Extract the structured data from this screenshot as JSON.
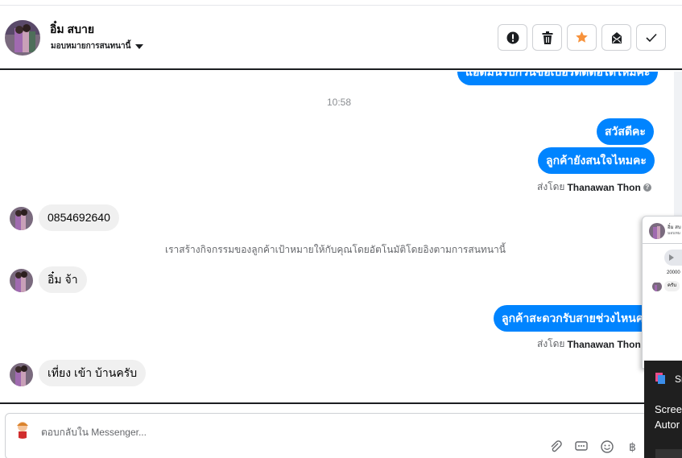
{
  "header": {
    "contact_name": "อิ๋ม สบาย",
    "assign_label": "มอบหมายการสนทนานี้",
    "actions": [
      {
        "name": "report",
        "icon": "exclamation-icon"
      },
      {
        "name": "delete",
        "icon": "trash-icon"
      },
      {
        "name": "star",
        "icon": "star-icon",
        "color": "#f7923b"
      },
      {
        "name": "move",
        "icon": "envelope-icon"
      },
      {
        "name": "done",
        "icon": "check-icon"
      }
    ]
  },
  "thread": {
    "cut_bubble": "แอดมินรบกวนขอเบอร์ติดต่อได้ไหมคะ",
    "time": "10:58",
    "out1": "สวัสดีคะ",
    "out2": "ลูกค้ายังสนใจไหมคะ",
    "sent_by_prefix": "ส่งโดย",
    "sent_by_name": "Thanawan Thon",
    "in1": "0854692640",
    "system_note": "เราสร้างกิจกรรมของลูกค้าเป้าหมายให้กับคุณโดยอัตโนมัติโดยอิงตามการสนทนานี้",
    "in2": "อิ๋ม จ้า",
    "out3": "ลูกค้าสะดวกรับสายช่วงไหนคะ",
    "sent_by_prefix2": "ส่งโดย",
    "sent_by_name2": "Thanawan Thon",
    "in3": "เที่ยง เข้า บ้านครับ"
  },
  "composer": {
    "placeholder": "ตอบกลับใน Messenger..."
  },
  "popup": {
    "name": "อิ๋ม สบ",
    "sub": "มอบหม",
    "number": "20000",
    "msg": "ครับ"
  },
  "toast": {
    "label": "Sn",
    "line1": "Scree",
    "line2": "Autor"
  },
  "colors": {
    "accent": "#0084ff",
    "incoming": "#f0f0f0"
  }
}
